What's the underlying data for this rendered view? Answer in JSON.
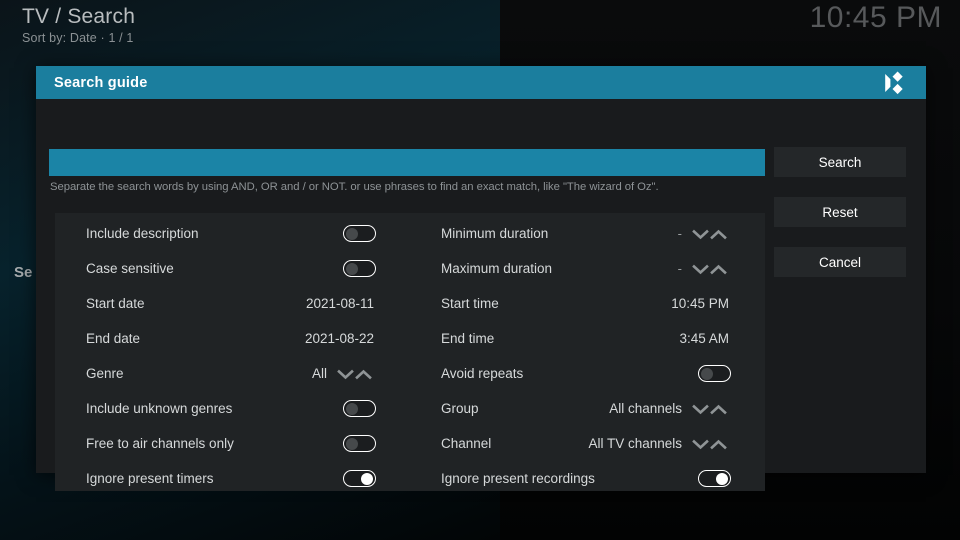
{
  "background": {
    "breadcrumb": "TV / Search",
    "subline": "Sort by: Date  ·  1 / 1",
    "clock": "10:45 PM",
    "side_label": "Se"
  },
  "dialog": {
    "title": "Search guide",
    "logo_icon": "kodi-logo-icon",
    "search": {
      "value": "",
      "placeholder": "",
      "hint": "Separate the search words by using AND, OR and / or NOT. or use phrases to find an exact match, like \"The wizard of Oz\"."
    },
    "buttons": [
      {
        "label": "Search",
        "name": "search-button"
      },
      {
        "label": "Reset",
        "name": "reset-button"
      },
      {
        "label": "Cancel",
        "name": "cancel-button"
      }
    ],
    "settings_left": [
      {
        "label": "Include description",
        "type": "toggle",
        "value": "off"
      },
      {
        "label": "Case sensitive",
        "type": "toggle",
        "value": "off"
      },
      {
        "label": "Start date",
        "type": "text",
        "value": "2021-08-11"
      },
      {
        "label": "End date",
        "type": "text",
        "value": "2021-08-22"
      },
      {
        "label": "Genre",
        "type": "spinner",
        "value": "All"
      },
      {
        "label": "Include unknown genres",
        "type": "toggle",
        "value": "off"
      },
      {
        "label": "Free to air channels only",
        "type": "toggle",
        "value": "off"
      },
      {
        "label": "Ignore present timers",
        "type": "toggle",
        "value": "on"
      }
    ],
    "settings_right": [
      {
        "label": "Minimum duration",
        "type": "spinner",
        "value": "-"
      },
      {
        "label": "Maximum duration",
        "type": "spinner",
        "value": "-"
      },
      {
        "label": "Start time",
        "type": "text",
        "value": "10:45 PM"
      },
      {
        "label": "End time",
        "type": "text",
        "value": "3:45 AM"
      },
      {
        "label": "Avoid repeats",
        "type": "toggle",
        "value": "off"
      },
      {
        "label": "Group",
        "type": "spinner",
        "value": "All channels"
      },
      {
        "label": "Channel",
        "type": "spinner",
        "value": "All TV channels"
      },
      {
        "label": "Ignore present recordings",
        "type": "toggle",
        "value": "on"
      }
    ]
  },
  "colors": {
    "accent_teal": "#1b7e9e",
    "field_teal": "#1b84a6",
    "dialog_bg": "#191b1d",
    "panel_bg": "#202325",
    "button_bg": "#242729",
    "text_primary": "#d6d9da"
  }
}
